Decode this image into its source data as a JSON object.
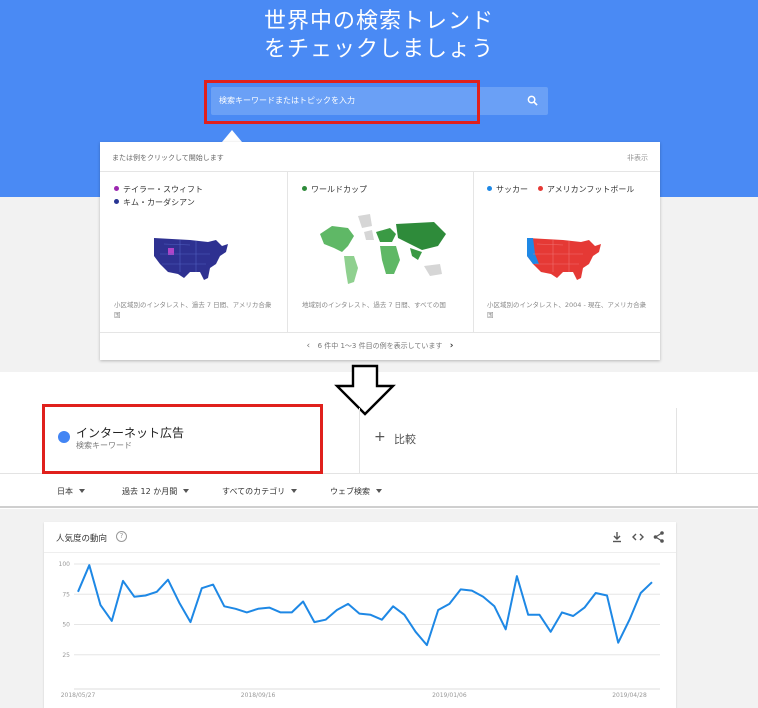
{
  "hero": {
    "title_line1": "世界中の検索トレンド",
    "title_line2": "をチェックしましょう",
    "search_placeholder": "検索キーワードまたはトピックを入力"
  },
  "examples": {
    "prompt": "または例をクリックして開始します",
    "hide": "非表示",
    "columns": [
      {
        "legend": [
          {
            "label": "テイラー・スウィフト",
            "color": "#9c27b0"
          },
          {
            "label": "キム・カーダシアン",
            "color": "#283593"
          }
        ],
        "description": "小区域別のインタレスト、過去 7 日間、アメリカ合衆国"
      },
      {
        "legend": [
          {
            "label": "ワールドカップ",
            "color": "#2e8b3a"
          }
        ],
        "description": "地域別のインタレスト、過去 7 日間、すべての国"
      },
      {
        "legend": [
          {
            "label": "サッカー",
            "color": "#1e88e5"
          },
          {
            "label": "アメリカンフットボール",
            "color": "#e53935"
          }
        ],
        "description": "小区域別のインタレスト、2004 - 現在、アメリカ合衆国"
      }
    ],
    "pager_text": "6 件中 1～3 件目の例を表示しています"
  },
  "term": {
    "name": "インターネット広告",
    "type": "検索キーワード",
    "color": "#4285f4"
  },
  "compare": {
    "label": "比較"
  },
  "filters": {
    "region": "日本",
    "period": "過去 12 か月間",
    "category": "すべてのカテゴリ",
    "search_type": "ウェブ検索"
  },
  "chart_card": {
    "title": "人気度の動向",
    "help": "?"
  },
  "chart_data": {
    "type": "line",
    "yticks": [
      25,
      50,
      75,
      100
    ],
    "ylim": [
      0,
      100
    ],
    "xticks": [
      "2018/05/27",
      "2018/09/16",
      "2019/01/06",
      "2019/04/28"
    ],
    "series": [
      {
        "color": "#1e88e5",
        "values": [
          77,
          99,
          66,
          53,
          86,
          73,
          74,
          77,
          87,
          68,
          52,
          80,
          83,
          65,
          63,
          60,
          63,
          64,
          60,
          60,
          69,
          52,
          54,
          62,
          67,
          59,
          58,
          54,
          65,
          58,
          44,
          33,
          62,
          67,
          79,
          78,
          73,
          65,
          46,
          90,
          58,
          58,
          44,
          60,
          57,
          64,
          76,
          74,
          35,
          54,
          76,
          85
        ]
      }
    ]
  }
}
